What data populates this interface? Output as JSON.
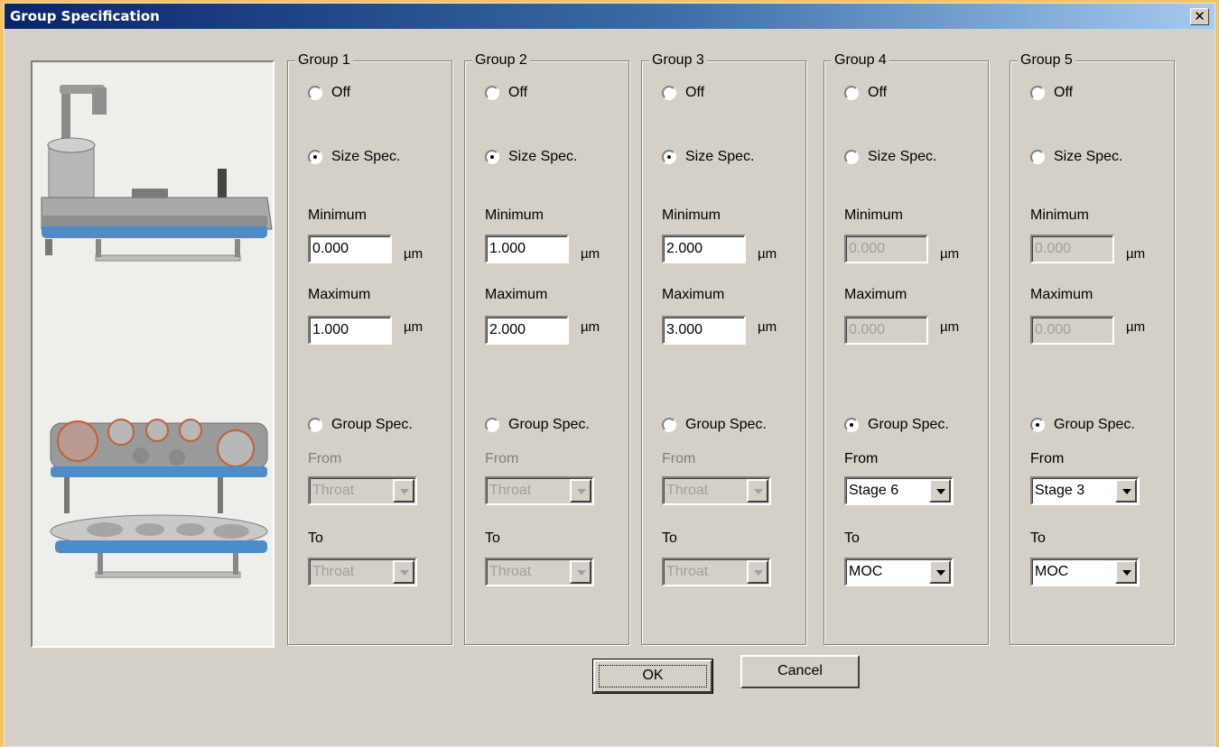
{
  "window": {
    "title": "Group Specification"
  },
  "groups": [
    {
      "legend": "Group 1",
      "off": "Off",
      "size": "Size Spec.",
      "selected": "size",
      "min_label": "Minimum",
      "min": "0.000",
      "max_label": "Maximum",
      "max": "1.000",
      "unit": "µm",
      "group": "Group Spec.",
      "from_label": "From",
      "from": "Throat",
      "to_label": "To",
      "to": "Throat",
      "size_enabled": true,
      "group_enabled": false
    },
    {
      "legend": "Group 2",
      "off": "Off",
      "size": "Size Spec.",
      "selected": "size",
      "min_label": "Minimum",
      "min": "1.000",
      "max_label": "Maximum",
      "max": "2.000",
      "unit": "µm",
      "group": "Group Spec.",
      "from_label": "From",
      "from": "Throat",
      "to_label": "To",
      "to": "Throat",
      "size_enabled": true,
      "group_enabled": false
    },
    {
      "legend": "Group 3",
      "off": "Off",
      "size": "Size Spec.",
      "selected": "size",
      "min_label": "Minimum",
      "min": "2.000",
      "max_label": "Maximum",
      "max": "3.000",
      "unit": "µm",
      "group": "Group Spec.",
      "from_label": "From",
      "from": "Throat",
      "to_label": "To",
      "to": "Throat",
      "size_enabled": true,
      "group_enabled": false
    },
    {
      "legend": "Group 4",
      "off": "Off",
      "size": "Size Spec.",
      "selected": "group",
      "min_label": "Minimum",
      "min": "0.000",
      "max_label": "Maximum",
      "max": "0.000",
      "unit": "µm",
      "group": "Group Spec.",
      "from_label": "From",
      "from": "Stage 6",
      "to_label": "To",
      "to": "MOC",
      "size_enabled": false,
      "group_enabled": true
    },
    {
      "legend": "Group 5",
      "off": "Off",
      "size": "Size Spec.",
      "selected": "group",
      "min_label": "Minimum",
      "min": "0.000",
      "max_label": "Maximum",
      "max": "0.000",
      "unit": "µm",
      "group": "Group Spec.",
      "from_label": "From",
      "from": "Stage 3",
      "to_label": "To",
      "to": "MOC",
      "size_enabled": false,
      "group_enabled": true
    }
  ],
  "buttons": {
    "ok": "OK",
    "cancel": "Cancel"
  }
}
